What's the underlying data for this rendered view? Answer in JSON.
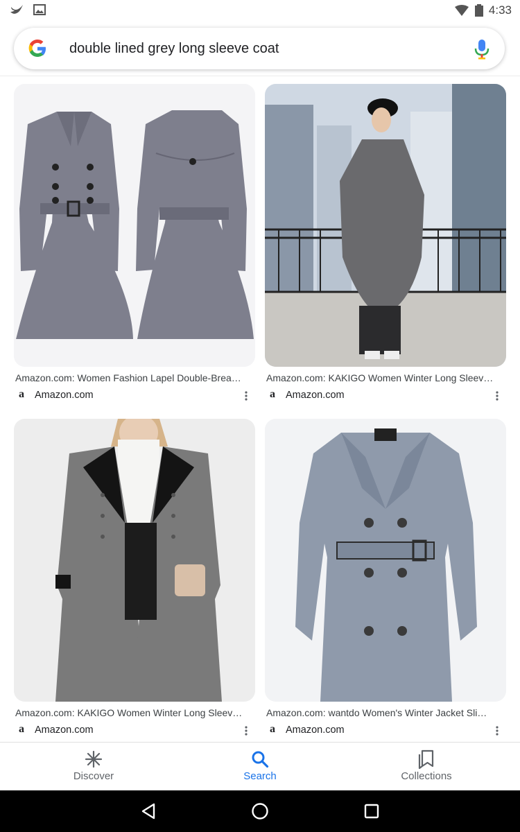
{
  "status_bar": {
    "time": "4:33",
    "icons": [
      "twitter-bird-icon",
      "image-icon",
      "wifi-icon",
      "battery-icon"
    ]
  },
  "search": {
    "query": "double lined grey long sleeve coat",
    "icons": [
      "google-logo",
      "mic-icon"
    ]
  },
  "results": [
    {
      "title": "Amazon.com: Women Fashion Lapel Double-Brea…",
      "source": "Amazon.com",
      "source_icon": "amazon-icon",
      "image": "two grey belted flared coats, front and back view"
    },
    {
      "title": "Amazon.com: KAKIGO Women Winter Long Sleev…",
      "source": "Amazon.com",
      "source_icon": "amazon-icon",
      "image": "woman in long grey coat on rooftop with city skyline"
    },
    {
      "title": "Amazon.com: KAKIGO Women Winter Long Sleev…",
      "source": "Amazon.com",
      "source_icon": "amazon-icon",
      "image": "woman wearing long grey coat with black lapels"
    },
    {
      "title": "Amazon.com: wantdo Women's Winter Jacket Sli…",
      "source": "Amazon.com",
      "source_icon": "amazon-icon",
      "image": "grey belted double-breasted trench coat"
    }
  ],
  "bottom_nav": {
    "items": [
      {
        "label": "Discover",
        "icon": "asterisk-icon",
        "active": false
      },
      {
        "label": "Search",
        "icon": "search-icon",
        "active": true
      },
      {
        "label": "Collections",
        "icon": "bookmark-collections-icon",
        "active": false
      }
    ]
  },
  "system_nav": {
    "icons": [
      "back-icon",
      "home-icon",
      "recents-icon"
    ]
  },
  "colors": {
    "accent": "#1a73e8",
    "coat_grey": "#7e7f8d",
    "text_secondary": "#5f6368"
  }
}
